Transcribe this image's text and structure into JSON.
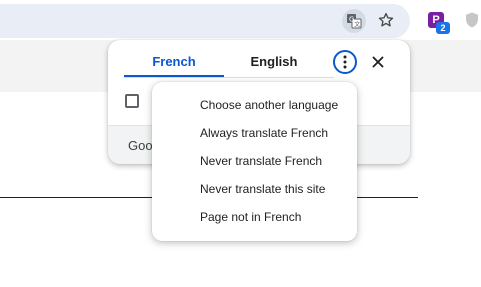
{
  "toolbar": {
    "icons": [
      "translate-icon",
      "star-icon",
      "extension-icon",
      "shield-icon"
    ],
    "extension_letter": "P",
    "extension_badge": "2"
  },
  "translate_bubble": {
    "tabs": [
      {
        "label": "French",
        "selected": true
      },
      {
        "label": "English",
        "selected": false
      }
    ],
    "footer_text": "Goo",
    "accent_color": "#0b57d0"
  },
  "menu": {
    "items": [
      {
        "label": "Choose another language"
      },
      {
        "label": "Always translate French"
      },
      {
        "label": "Never translate French"
      },
      {
        "label": "Never translate this site"
      },
      {
        "label": "Page not in French"
      }
    ]
  }
}
